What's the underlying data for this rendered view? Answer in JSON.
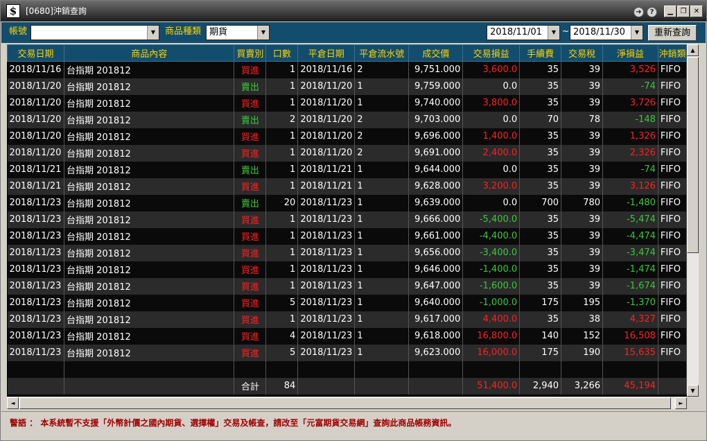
{
  "window": {
    "logo": "$",
    "title": "[0680]沖銷查詢",
    "icons": [
      "arrow-icon",
      "help-icon",
      "minimize-icon",
      "maximize-icon",
      "close-icon"
    ],
    "help_glyph": "?",
    "arrow_glyph": "➜"
  },
  "toolbar": {
    "account_label": "帳號",
    "account_value": "",
    "product_type_label": "商品種類",
    "product_type_value": "期貨",
    "date_from": "2018/11/01",
    "date_sep": "~",
    "date_to": "2018/11/30",
    "requery_label": "重新查詢"
  },
  "table": {
    "columns": [
      "交易日期",
      "商品內容",
      "買賣別",
      "口數",
      "平倉日期",
      "平倉流水號",
      "成交價",
      "交易損益",
      "手續費",
      "交易稅",
      "淨損益",
      "沖銷類"
    ],
    "rows": [
      [
        "2018/11/16",
        "台指期 201812",
        "買進",
        "1",
        "2018/11/16",
        "2",
        "9,751.000",
        "3,600.0",
        "35",
        "39",
        "3,526",
        "FIFO"
      ],
      [
        "2018/11/20",
        "台指期 201812",
        "賣出",
        "1",
        "2018/11/20",
        "1",
        "9,759.000",
        "0.0",
        "35",
        "39",
        "-74",
        "FIFO"
      ],
      [
        "2018/11/20",
        "台指期 201812",
        "買進",
        "1",
        "2018/11/20",
        "1",
        "9,740.000",
        "3,800.0",
        "35",
        "39",
        "3,726",
        "FIFO"
      ],
      [
        "2018/11/20",
        "台指期 201812",
        "賣出",
        "2",
        "2018/11/20",
        "2",
        "9,703.000",
        "0.0",
        "70",
        "78",
        "-148",
        "FIFO"
      ],
      [
        "2018/11/20",
        "台指期 201812",
        "買進",
        "1",
        "2018/11/20",
        "2",
        "9,696.000",
        "1,400.0",
        "35",
        "39",
        "1,326",
        "FIFO"
      ],
      [
        "2018/11/20",
        "台指期 201812",
        "買進",
        "1",
        "2018/11/20",
        "2",
        "9,691.000",
        "2,400.0",
        "35",
        "39",
        "2,326",
        "FIFO"
      ],
      [
        "2018/11/21",
        "台指期 201812",
        "賣出",
        "1",
        "2018/11/21",
        "1",
        "9,644.000",
        "0.0",
        "35",
        "39",
        "-74",
        "FIFO"
      ],
      [
        "2018/11/21",
        "台指期 201812",
        "買進",
        "1",
        "2018/11/21",
        "1",
        "9,628.000",
        "3,200.0",
        "35",
        "39",
        "3,126",
        "FIFO"
      ],
      [
        "2018/11/23",
        "台指期 201812",
        "賣出",
        "20",
        "2018/11/23",
        "1",
        "9,639.000",
        "0.0",
        "700",
        "780",
        "-1,480",
        "FIFO"
      ],
      [
        "2018/11/23",
        "台指期 201812",
        "買進",
        "1",
        "2018/11/23",
        "1",
        "9,666.000",
        "-5,400.0",
        "35",
        "39",
        "-5,474",
        "FIFO"
      ],
      [
        "2018/11/23",
        "台指期 201812",
        "買進",
        "1",
        "2018/11/23",
        "1",
        "9,661.000",
        "-4,400.0",
        "35",
        "39",
        "-4,474",
        "FIFO"
      ],
      [
        "2018/11/23",
        "台指期 201812",
        "買進",
        "1",
        "2018/11/23",
        "1",
        "9,656.000",
        "-3,400.0",
        "35",
        "39",
        "-3,474",
        "FIFO"
      ],
      [
        "2018/11/23",
        "台指期 201812",
        "買進",
        "1",
        "2018/11/23",
        "1",
        "9,646.000",
        "-1,400.0",
        "35",
        "39",
        "-1,474",
        "FIFO"
      ],
      [
        "2018/11/23",
        "台指期 201812",
        "買進",
        "1",
        "2018/11/23",
        "1",
        "9,647.000",
        "-1,600.0",
        "35",
        "39",
        "-1,674",
        "FIFO"
      ],
      [
        "2018/11/23",
        "台指期 201812",
        "買進",
        "5",
        "2018/11/23",
        "1",
        "9,640.000",
        "-1,000.0",
        "175",
        "195",
        "-1,370",
        "FIFO"
      ],
      [
        "2018/11/23",
        "台指期 201812",
        "買進",
        "1",
        "2018/11/23",
        "1",
        "9,617.000",
        "4,400.0",
        "35",
        "38",
        "4,327",
        "FIFO"
      ],
      [
        "2018/11/23",
        "台指期 201812",
        "買進",
        "4",
        "2018/11/23",
        "1",
        "9,618.000",
        "16,800.0",
        "140",
        "152",
        "16,508",
        "FIFO"
      ],
      [
        "2018/11/23",
        "台指期 201812",
        "買進",
        "5",
        "2018/11/23",
        "1",
        "9,623.000",
        "16,000.0",
        "175",
        "190",
        "15,635",
        "FIFO"
      ]
    ],
    "totals": {
      "label": "合計",
      "qty": "84",
      "trade_pnl": "51,400.0",
      "fee": "2,940",
      "tax": "3,266",
      "net_pnl": "45,194"
    }
  },
  "colors": {
    "buy": "#ff2020",
    "sell": "#38c838",
    "header_bg": "#124d6d",
    "header_text": "#ffd200",
    "warning_text": "#a00000"
  },
  "scroll": {
    "up_glyph": "▲",
    "down_glyph": "▼",
    "left_glyph": "◄",
    "right_glyph": "►",
    "vertical_position": 0,
    "horizontal_position": 0
  },
  "warning": "警語 ： 本系統暫不支援「外幣計價之國內期貨、選擇權」交易及帳查，請改至「元富期貨交易網」查詢此商品帳務資訊。"
}
